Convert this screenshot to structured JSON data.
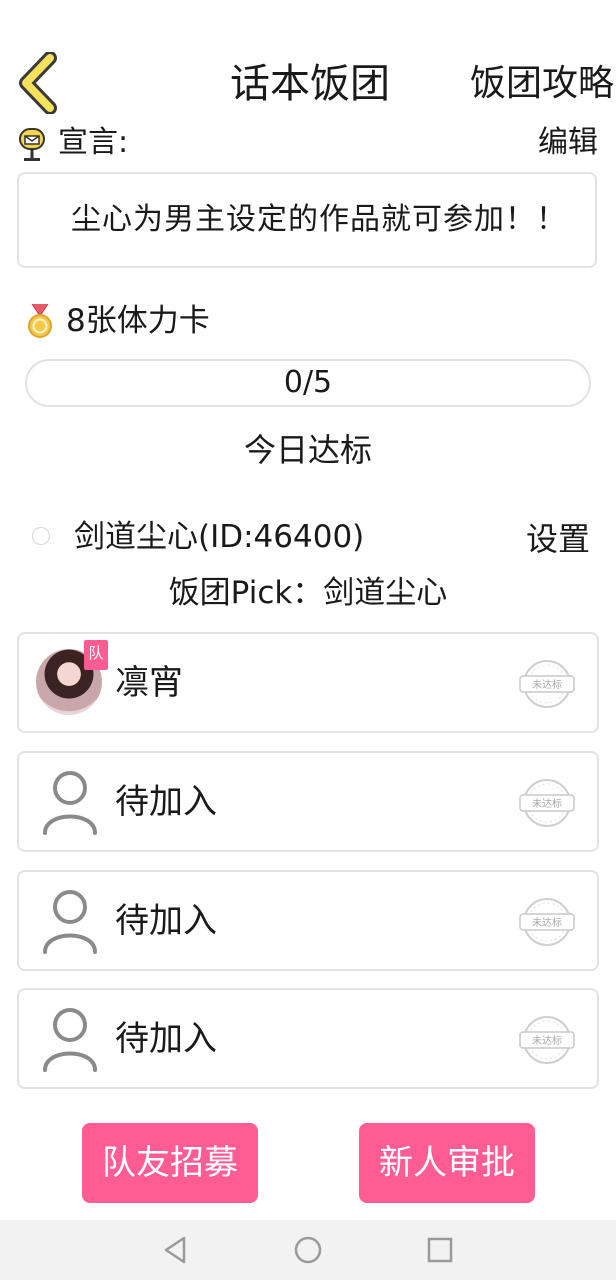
{
  "header": {
    "title": "话本饭团",
    "strategy_link": "饭团攻略"
  },
  "declaration": {
    "label": "宣言:",
    "edit_label": "编辑",
    "text": "尘心为男主设定的作品就可参加！！"
  },
  "reward": {
    "text": "8张体力卡"
  },
  "progress": {
    "current": 0,
    "total": 5,
    "label": "0/5",
    "caption": "今日达标"
  },
  "leader": {
    "name": "剑道尘心(ID:46400)",
    "settings_label": "设置",
    "pick": "饭团Pick：剑道尘心"
  },
  "members": [
    {
      "name": "凛宵",
      "tag": "队",
      "stamp": "未达标",
      "is_leader": true
    },
    {
      "name": "待加入",
      "stamp": "未达标",
      "is_leader": false
    },
    {
      "name": "待加入",
      "stamp": "未达标",
      "is_leader": false
    },
    {
      "name": "待加入",
      "stamp": "未达标",
      "is_leader": false
    }
  ],
  "actions": {
    "recruit": "队友招募",
    "approve": "新人审批"
  },
  "icons": {
    "back": "back-chevron-icon",
    "declaration": "mailbox-icon",
    "reward": "medal-icon",
    "placeholder_avatar": "person-icon",
    "status": "stamp-icon"
  },
  "colors": {
    "accent": "#ff5c93",
    "back_arrow_fill": "#f5e15a",
    "back_arrow_stroke": "#3a3a3a",
    "border": "#e3e3e3",
    "placeholder_gray": "#8a8a8a"
  }
}
